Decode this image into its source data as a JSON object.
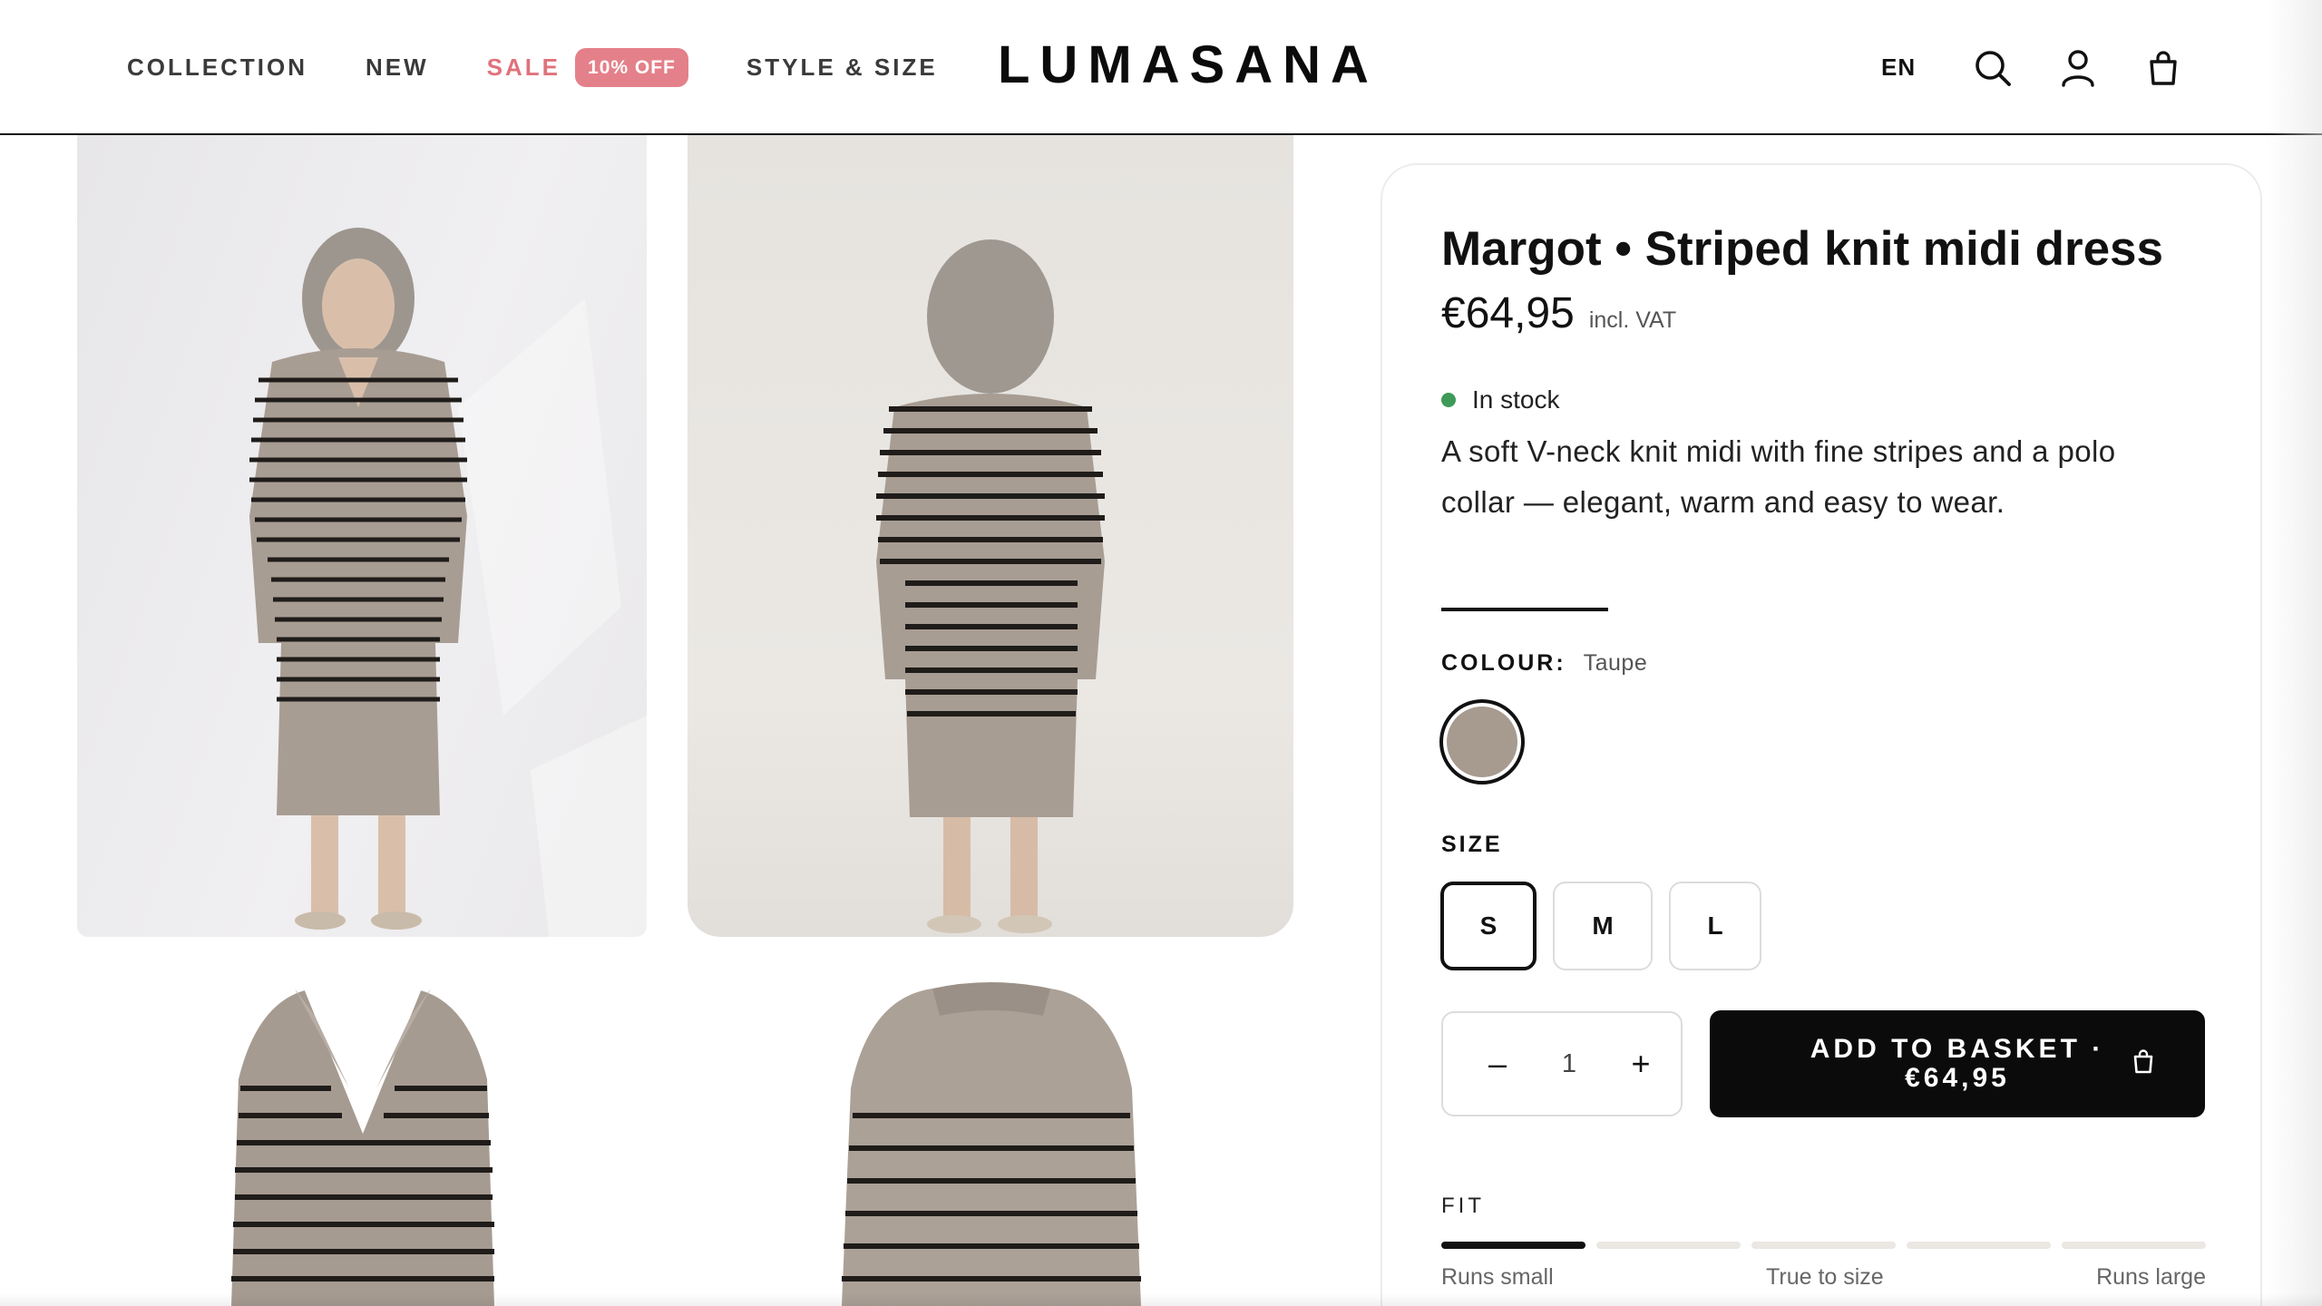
{
  "header": {
    "nav": {
      "collection": "COLLECTION",
      "new": "NEW",
      "sale": "SALE",
      "sale_badge": "10% OFF",
      "style_size": "STYLE & SIZE"
    },
    "logo": "LUMASANA",
    "language": "EN",
    "icons": [
      "search-icon",
      "account-icon",
      "basket-icon"
    ]
  },
  "product": {
    "title": "Margot • Striped knit midi dress",
    "price": "€64,95",
    "vat_note": "incl. VAT",
    "stock": "In stock",
    "stock_color": "#3f9a57",
    "description": "A soft V-neck knit midi with fine stripes and a polo collar — elegant, warm and easy to wear.",
    "colour_label": "COLOUR:",
    "colour_value": "Taupe",
    "swatch_color": "#a79a8f",
    "size_label": "SIZE",
    "sizes": [
      "S",
      "M",
      "L"
    ],
    "selected_size": "S",
    "quantity": "1",
    "qty_minus": "–",
    "qty_plus": "+",
    "add_to_basket": "ADD TO BASKET · €64,95",
    "fit_label": "FIT",
    "fit_scale": [
      "Runs small",
      "True to size",
      "Runs large"
    ],
    "fit_level_fraction": 0.2
  }
}
